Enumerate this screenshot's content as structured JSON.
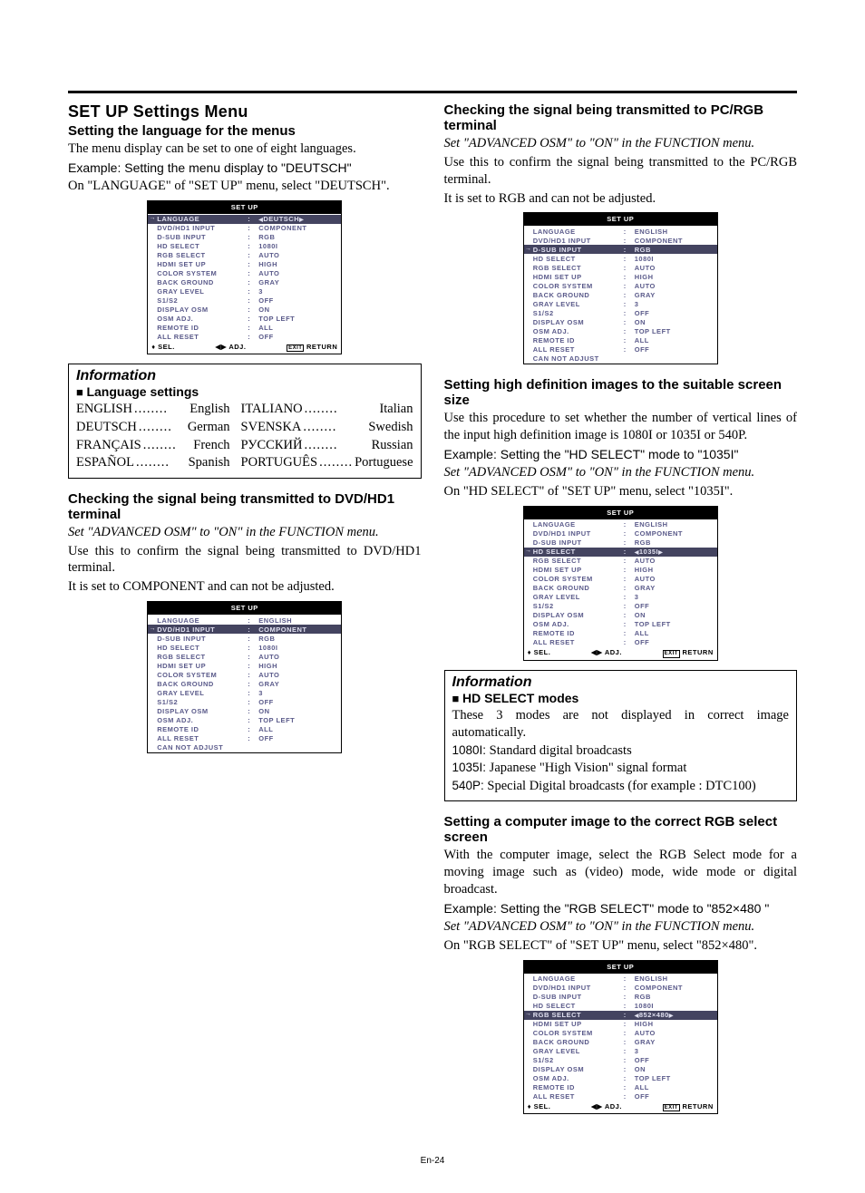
{
  "page_number": "En-24",
  "left": {
    "title": "SET UP Settings Menu",
    "sec1": {
      "heading": "Setting the language for the menus",
      "p1": "The menu display can be set to one of eight languages.",
      "p2": "Example: Setting the menu display to \"DEUTSCH\"",
      "p3": "On \"LANGUAGE\" of \"SET UP\" menu, select \"DEUTSCH\".",
      "osd": {
        "title": "SET UP",
        "rows": [
          {
            "label": "LANGUAGE",
            "value": "DEUTSCH",
            "highlight": true,
            "arrows": true
          },
          {
            "label": "DVD/HD1 INPUT",
            "value": "COMPONENT"
          },
          {
            "label": "D-SUB INPUT",
            "value": "RGB"
          },
          {
            "label": "HD SELECT",
            "value": "1080I"
          },
          {
            "label": "RGB SELECT",
            "value": "AUTO"
          },
          {
            "label": "HDMI SET UP",
            "value": "HIGH"
          },
          {
            "label": "COLOR SYSTEM",
            "value": "AUTO"
          },
          {
            "label": "BACK GROUND",
            "value": "GRAY"
          },
          {
            "label": "GRAY LEVEL",
            "value": "3"
          },
          {
            "label": "S1/S2",
            "value": "OFF"
          },
          {
            "label": "DISPLAY OSM",
            "value": "ON"
          },
          {
            "label": "OSM ADJ.",
            "value": "TOP LEFT"
          },
          {
            "label": "REMOTE ID",
            "value": "ALL"
          },
          {
            "label": "ALL RESET",
            "value": "OFF"
          }
        ],
        "footer": {
          "sel": "SEL.",
          "adj": "ADJ.",
          "exit": "EXIT",
          "ret": "RETURN"
        }
      }
    },
    "info1": {
      "header": "Information",
      "sub": "Language settings",
      "langs_left": [
        {
          "native": "ENGLISH",
          "name": "English"
        },
        {
          "native": "DEUTSCH",
          "name": "German"
        },
        {
          "native": "FRANÇAIS",
          "name": "French"
        },
        {
          "native": "ESPAÑOL",
          "name": "Spanish"
        }
      ],
      "langs_right": [
        {
          "native": "ITALIANO",
          "name": "Italian"
        },
        {
          "native": "SVENSKA",
          "name": "Swedish"
        },
        {
          "native": "РУССКИЙ",
          "name": "Russian"
        },
        {
          "native": "PORTUGUÊS",
          "name": "Portuguese"
        }
      ]
    },
    "sec2": {
      "heading": "Checking the signal being transmitted to DVD/HD1 terminal",
      "p1": "Set \"ADVANCED OSM\" to \"ON\" in the FUNCTION menu.",
      "p2": "Use this to confirm the signal being transmitted to DVD/HD1 terminal.",
      "p3": "It is set to COMPONENT and can not be adjusted.",
      "osd": {
        "title": "SET UP",
        "rows": [
          {
            "label": "LANGUAGE",
            "value": "ENGLISH"
          },
          {
            "label": "DVD/HD1 INPUT",
            "value": "COMPONENT",
            "highlight": true
          },
          {
            "label": "D-SUB INPUT",
            "value": "RGB"
          },
          {
            "label": "HD SELECT",
            "value": "1080I"
          },
          {
            "label": "RGB SELECT",
            "value": "AUTO"
          },
          {
            "label": "HDMI SET UP",
            "value": "HIGH"
          },
          {
            "label": "COLOR SYSTEM",
            "value": "AUTO"
          },
          {
            "label": "BACK GROUND",
            "value": "GRAY"
          },
          {
            "label": "GRAY LEVEL",
            "value": "3"
          },
          {
            "label": "S1/S2",
            "value": "OFF"
          },
          {
            "label": "DISPLAY OSM",
            "value": "ON"
          },
          {
            "label": "OSM ADJ.",
            "value": "TOP LEFT"
          },
          {
            "label": "REMOTE ID",
            "value": "ALL"
          },
          {
            "label": "ALL RESET",
            "value": "OFF"
          }
        ],
        "note": "CAN NOT ADJUST"
      }
    }
  },
  "right": {
    "sec1": {
      "heading": "Checking the signal being transmitted to PC/RGB terminal",
      "p1": "Set \"ADVANCED OSM\" to \"ON\" in the FUNCTION menu.",
      "p2": "Use this to confirm the signal being transmitted to the PC/RGB terminal.",
      "p3": "It is set to RGB and can not be adjusted.",
      "osd": {
        "title": "SET UP",
        "rows": [
          {
            "label": "LANGUAGE",
            "value": "ENGLISH"
          },
          {
            "label": "DVD/HD1 INPUT",
            "value": "COMPONENT"
          },
          {
            "label": "D-SUB INPUT",
            "value": "RGB",
            "highlight": true
          },
          {
            "label": "HD SELECT",
            "value": "1080I"
          },
          {
            "label": "RGB SELECT",
            "value": "AUTO"
          },
          {
            "label": "HDMI SET UP",
            "value": "HIGH"
          },
          {
            "label": "COLOR SYSTEM",
            "value": "AUTO"
          },
          {
            "label": "BACK GROUND",
            "value": "GRAY"
          },
          {
            "label": "GRAY LEVEL",
            "value": "3"
          },
          {
            "label": "S1/S2",
            "value": "OFF"
          },
          {
            "label": "DISPLAY OSM",
            "value": "ON"
          },
          {
            "label": "OSM ADJ.",
            "value": "TOP LEFT"
          },
          {
            "label": "REMOTE ID",
            "value": "ALL"
          },
          {
            "label": "ALL RESET",
            "value": "OFF"
          }
        ],
        "note": "CAN NOT ADJUST"
      }
    },
    "sec2": {
      "heading": "Setting high definition images to the suitable screen size",
      "p1": "Use this procedure to set whether the number of vertical lines of the input high definition image is 1080I or 1035I or 540P.",
      "p2": "Example: Setting the \"HD SELECT\" mode to \"1035I\"",
      "p3": "Set \"ADVANCED OSM\" to \"ON\" in the FUNCTION menu.",
      "p4": "On \"HD SELECT\" of \"SET UP\" menu, select \"1035I\".",
      "osd": {
        "title": "SET UP",
        "rows": [
          {
            "label": "LANGUAGE",
            "value": "ENGLISH"
          },
          {
            "label": "DVD/HD1 INPUT",
            "value": "COMPONENT"
          },
          {
            "label": "D-SUB INPUT",
            "value": "RGB"
          },
          {
            "label": "HD SELECT",
            "value": "1035I",
            "highlight": true,
            "arrows": true
          },
          {
            "label": "RGB SELECT",
            "value": "AUTO"
          },
          {
            "label": "HDMI SET UP",
            "value": "HIGH"
          },
          {
            "label": "COLOR SYSTEM",
            "value": "AUTO"
          },
          {
            "label": "BACK GROUND",
            "value": "GRAY"
          },
          {
            "label": "GRAY LEVEL",
            "value": "3"
          },
          {
            "label": "S1/S2",
            "value": "OFF"
          },
          {
            "label": "DISPLAY OSM",
            "value": "ON"
          },
          {
            "label": "OSM ADJ.",
            "value": "TOP LEFT"
          },
          {
            "label": "REMOTE ID",
            "value": "ALL"
          },
          {
            "label": "ALL RESET",
            "value": "OFF"
          }
        ],
        "footer": {
          "sel": "SEL.",
          "adj": "ADJ.",
          "exit": "EXIT",
          "ret": "RETURN"
        }
      }
    },
    "info2": {
      "header": "Information",
      "sub": "HD SELECT modes",
      "intro": "These 3 modes are not displayed in correct image automatically.",
      "m1_label": "1080I:",
      "m1_text": " Standard digital broadcasts",
      "m2_label": "1035I:",
      "m2_text": " Japanese \"High Vision\" signal format",
      "m3_label": "540P:",
      "m3_text": " Special Digital broadcasts (for example : DTC100)"
    },
    "sec3": {
      "heading": "Setting a computer image to the correct RGB select screen",
      "p1": "With the computer image, select the RGB Select mode for a moving image such as (video) mode, wide mode or digital broadcast.",
      "p2": "Example: Setting the \"RGB SELECT\" mode to \"852×480 \"",
      "p3": "Set \"ADVANCED OSM\" to \"ON\" in the FUNCTION menu.",
      "p4": "On \"RGB SELECT\" of \"SET UP\" menu, select \"852×480\".",
      "osd": {
        "title": "SET UP",
        "rows": [
          {
            "label": "LANGUAGE",
            "value": "ENGLISH"
          },
          {
            "label": "DVD/HD1 INPUT",
            "value": "COMPONENT"
          },
          {
            "label": "D-SUB INPUT",
            "value": "RGB"
          },
          {
            "label": "HD SELECT",
            "value": "1080I"
          },
          {
            "label": "RGB SELECT",
            "value": "852×480",
            "highlight": true,
            "arrows": true
          },
          {
            "label": "HDMI SET UP",
            "value": "HIGH"
          },
          {
            "label": "COLOR SYSTEM",
            "value": "AUTO"
          },
          {
            "label": "BACK GROUND",
            "value": "GRAY"
          },
          {
            "label": "GRAY LEVEL",
            "value": "3"
          },
          {
            "label": "S1/S2",
            "value": "OFF"
          },
          {
            "label": "DISPLAY OSM",
            "value": "ON"
          },
          {
            "label": "OSM ADJ.",
            "value": "TOP LEFT"
          },
          {
            "label": "REMOTE ID",
            "value": "ALL"
          },
          {
            "label": "ALL RESET",
            "value": "OFF"
          }
        ],
        "footer": {
          "sel": "SEL.",
          "adj": "ADJ.",
          "exit": "EXIT",
          "ret": "RETURN"
        }
      }
    }
  }
}
